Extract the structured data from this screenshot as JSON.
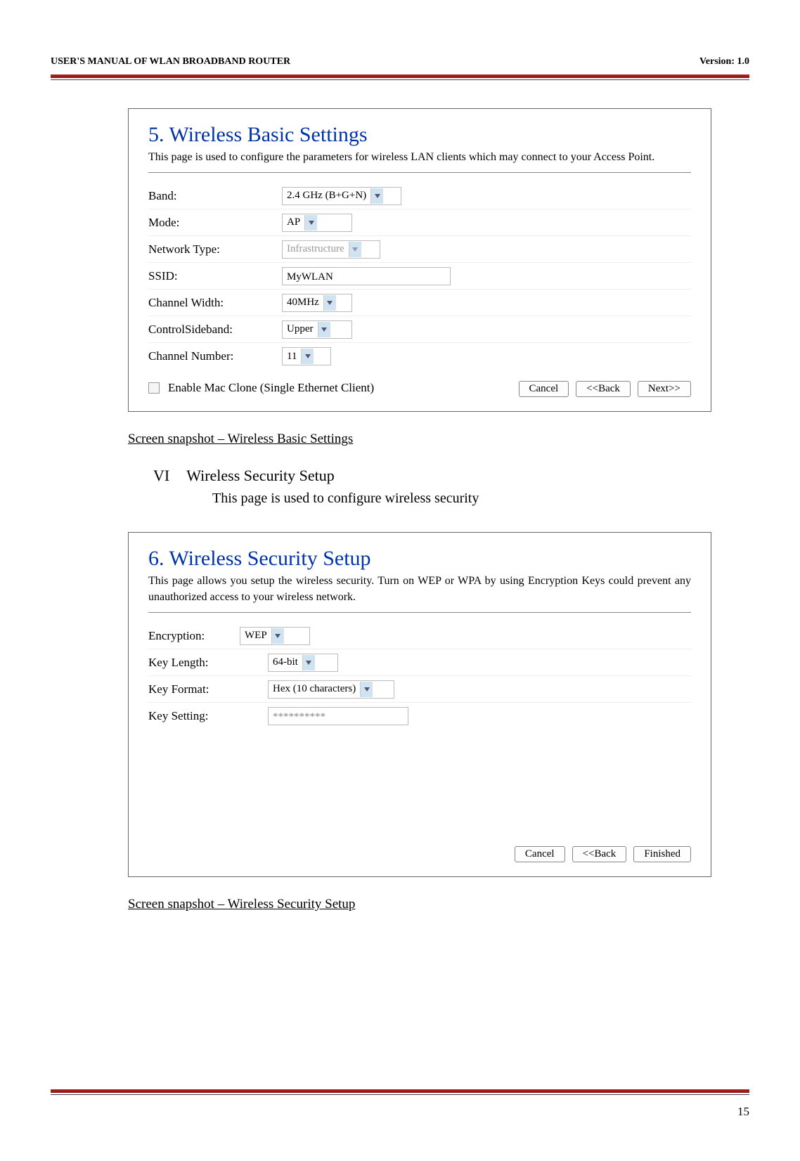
{
  "header": {
    "left": "USER'S MANUAL OF WLAN BROADBAND ROUTER",
    "right": "Version: 1.0"
  },
  "panel1": {
    "title": "5. Wireless Basic Settings",
    "desc": "This page is used to configure the parameters for wireless LAN clients which may connect to your Access Point.",
    "rows": {
      "band_label": "Band:",
      "band_value": "2.4 GHz (B+G+N)",
      "mode_label": "Mode:",
      "mode_value": "AP",
      "nettype_label": "Network Type:",
      "nettype_value": "Infrastructure",
      "ssid_label": "SSID:",
      "ssid_value": "MyWLAN",
      "chwidth_label": "Channel Width:",
      "chwidth_value": "40MHz",
      "sideband_label": "ControlSideband:",
      "sideband_value": "Upper",
      "chnum_label": "Channel Number:",
      "chnum_value": "11"
    },
    "checkbox_label": "Enable Mac Clone (Single Ethernet Client)",
    "buttons": {
      "cancel": "Cancel",
      "back": "<<Back",
      "next": "Next>>"
    }
  },
  "caption1": "Screen snapshot – Wireless Basic Settings",
  "section": {
    "roman": "VI",
    "title": "Wireless Security Setup",
    "body": "This page is used to configure wireless security"
  },
  "panel2": {
    "title": "6. Wireless Security Setup",
    "desc": "This page allows you setup the wireless security. Turn on WEP or WPA by using Encryption Keys could prevent any unauthorized access to your wireless network.",
    "rows": {
      "enc_label": "Encryption:",
      "enc_value": "WEP",
      "keylen_label": "Key Length:",
      "keylen_value": "64-bit",
      "keyfmt_label": "Key Format:",
      "keyfmt_value": "Hex (10 characters)",
      "keyset_label": "Key Setting:",
      "keyset_value": "**********"
    },
    "buttons": {
      "cancel": "Cancel",
      "back": "<<Back",
      "finish": "Finished"
    }
  },
  "caption2": "Screen snapshot – Wireless Security Setup",
  "page_number": "15"
}
